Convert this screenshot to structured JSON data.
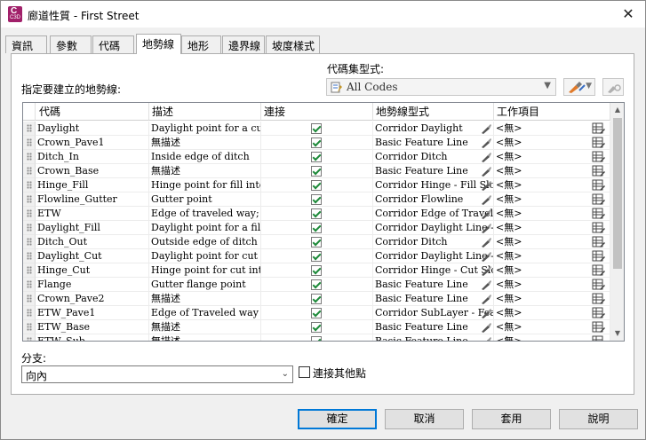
{
  "window": {
    "title": "廊道性質 - First Street",
    "app_icon_letter": "C",
    "app_icon_version": "C3D",
    "close_glyph": "✕"
  },
  "tabs": [
    "資訊",
    "參數",
    "代碼",
    "地勢線",
    "地形",
    "邊界線",
    "坡度樣式"
  ],
  "active_tab": "地勢線",
  "code_set": {
    "label": "代碼集型式:",
    "value": "All Codes"
  },
  "specify_label": "指定要建立的地勢線:",
  "grid": {
    "columns": [
      "代碼",
      "描述",
      "連接",
      "地勢線型式",
      "工作項目"
    ],
    "rows": [
      {
        "code": "Daylight",
        "desc": "Daylight point for a cut ...",
        "connect": true,
        "style": "Corridor Daylight",
        "work": "<無>"
      },
      {
        "code": "Crown_Pave1",
        "desc": "無描述",
        "connect": true,
        "style": "Basic Feature Line",
        "work": "<無>"
      },
      {
        "code": "Ditch_In",
        "desc": "Inside edge of ditch",
        "connect": true,
        "style": "Corridor Ditch",
        "work": "<無>"
      },
      {
        "code": "Crown_Base",
        "desc": "無描述",
        "connect": true,
        "style": "Basic Feature Line",
        "work": "<無>"
      },
      {
        "code": "Hinge_Fill",
        "desc": "Hinge point for fill inter...",
        "connect": true,
        "style": "Corridor Hinge - Fill Slope",
        "work": "<無>"
      },
      {
        "code": "Flowline_Gutter",
        "desc": "Gutter point",
        "connect": true,
        "style": "Corridor Flowline",
        "work": "<無>"
      },
      {
        "code": "ETW",
        "desc": "Edge of traveled way; in...",
        "connect": true,
        "style": "Corridor Edge of Travel Way",
        "work": "<無>"
      },
      {
        "code": "Daylight_Fill",
        "desc": "Daylight point for a fill s...",
        "connect": true,
        "style": "Corridor Daylight Line - Fill",
        "work": "<無>"
      },
      {
        "code": "Ditch_Out",
        "desc": "Outside edge of ditch",
        "connect": true,
        "style": "Corridor Ditch",
        "work": "<無>"
      },
      {
        "code": "Daylight_Cut",
        "desc": "Daylight point for cut sl...",
        "connect": true,
        "style": "Corridor Daylight Line - Cut",
        "work": "<無>"
      },
      {
        "code": "Hinge_Cut",
        "desc": "Hinge point for cut inter...",
        "connect": true,
        "style": "Corridor Hinge - Cut Slope",
        "work": "<無>"
      },
      {
        "code": "Flange",
        "desc": "Gutter flange point",
        "connect": true,
        "style": "Basic Feature Line",
        "work": "<無>"
      },
      {
        "code": "Crown_Pave2",
        "desc": "無描述",
        "connect": true,
        "style": "Basic Feature Line",
        "work": "<無>"
      },
      {
        "code": "ETW_Pave1",
        "desc": "Edge of Traveled way o...",
        "connect": true,
        "style": "Corridor SubLayer - Feature",
        "work": "<無>"
      },
      {
        "code": "ETW_Base",
        "desc": "無描述",
        "connect": true,
        "style": "Basic Feature Line",
        "work": "<無>"
      },
      {
        "code": "ETW_Sub",
        "desc": "無描述",
        "connect": true,
        "style": "Basic Feature Line",
        "work": "<無>"
      }
    ]
  },
  "branch": {
    "label": "分支:",
    "value": "向內"
  },
  "connect_extra": {
    "label": "連接其他點",
    "checked": false
  },
  "buttons": {
    "ok": "確定",
    "cancel": "取消",
    "apply": "套用",
    "help": "說明"
  },
  "colors": {
    "check_green": "#1e8a3a",
    "primary_border": "#0078d7",
    "app_icon": "#a1206a"
  }
}
